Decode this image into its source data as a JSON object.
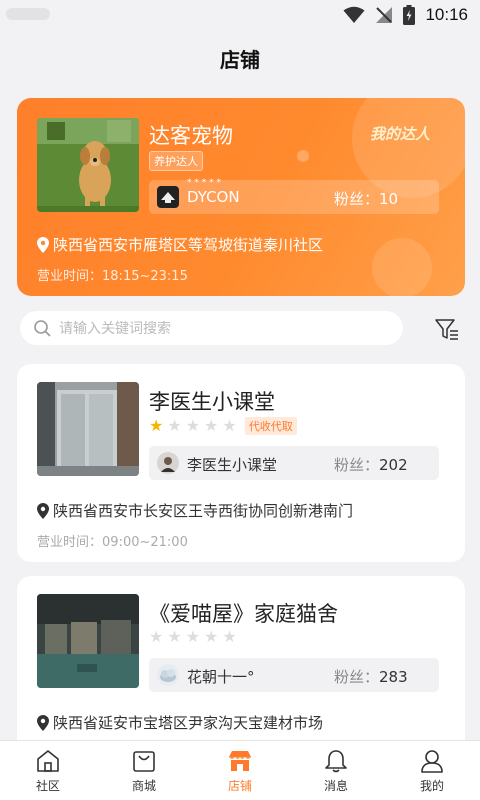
{
  "status_bar": {
    "time": "10:16"
  },
  "header": {
    "title": "店铺"
  },
  "featured": {
    "name": "达客宠物",
    "tag": "养护达人",
    "badge": "我的达人",
    "owner_name": "DYCON",
    "owner_stars": "* * * * *",
    "fans_label": "粉丝：",
    "fans_count": "10",
    "address": "陕西省西安市雁塔区等驾坡街道秦川社区",
    "hours_label": "营业时间：",
    "hours": "18:15~23:15"
  },
  "search": {
    "placeholder": "请输入关键词搜索"
  },
  "stores": [
    {
      "name": "李医生小课堂",
      "rating": 1,
      "tag": "代收代取",
      "owner_name": "李医生小课堂",
      "fans_label": "粉丝：",
      "fans_count": "202",
      "address": "陕西省西安市长安区王寺西街协同创新港南门",
      "hours_label": "营业时间：",
      "hours": "09:00~21:00"
    },
    {
      "name": "《爱喵屋》家庭猫舍",
      "rating": 0,
      "owner_name": "花朝十一°",
      "fans_label": "粉丝：",
      "fans_count": "283",
      "address": "陕西省延安市宝塔区尹家沟天宝建材市场"
    }
  ],
  "tabs": [
    {
      "label": "社区",
      "icon": "home-icon"
    },
    {
      "label": "商城",
      "icon": "shopping-bag-icon"
    },
    {
      "label": "店铺",
      "icon": "store-icon",
      "active": true
    },
    {
      "label": "消息",
      "icon": "bell-icon"
    },
    {
      "label": "我的",
      "icon": "user-icon"
    }
  ],
  "colors": {
    "accent": "#ff7a2a",
    "star": "#f6b500"
  }
}
